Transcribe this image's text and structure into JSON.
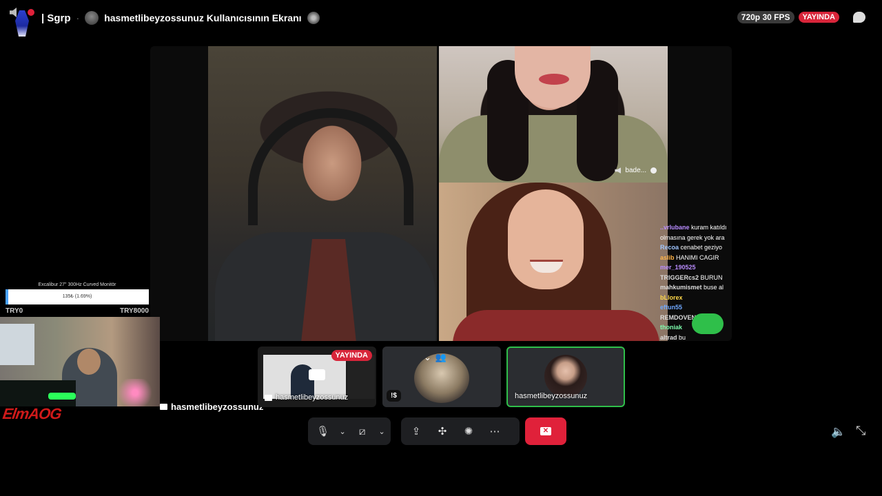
{
  "header": {
    "server_name": "| Sgrp",
    "separator": "·",
    "stream_title": "hasmetlibeyzossunuz Kullanıcısının Ekranı",
    "quality": "720p 30 FPS",
    "live_badge": "YAYINDA"
  },
  "stage": {
    "main_tile_name": "hasmetlibeyzossunuz",
    "top_right_name": "bade...",
    "chat_lines": [
      {
        "user": "..vrlubane",
        "text": "kuram katıldı",
        "color": "#b98cff"
      },
      {
        "user": "",
        "text": "olmasına gerek yok ara",
        "color": "#ddd"
      },
      {
        "user": "Recoa",
        "text": "cenabet geziyo",
        "color": "#9fc5ff"
      },
      {
        "user": "aslib",
        "text": "HANIMI CAGIR",
        "color": "#ffb347"
      },
      {
        "user": "mer_190525",
        "text": "",
        "color": "#b98cff"
      },
      {
        "user": "TRIGGERcs2",
        "text": "BURUN",
        "color": "#ddd"
      },
      {
        "user": "mahkumismet",
        "text": "buse al",
        "color": "#ddd"
      },
      {
        "user": "bLlorex",
        "text": "",
        "color": "#ffd84a"
      },
      {
        "user": "eftun55",
        "text": "",
        "color": "#6fa8ff"
      },
      {
        "user": "REMDOVEN",
        "text": "neden",
        "color": "#ddd"
      },
      {
        "user": "thoniak",
        "text": "",
        "color": "#7fffaf"
      },
      {
        "user": "altrad",
        "text": "bu",
        "color": "#ddd"
      }
    ]
  },
  "goal": {
    "title": "Excalibur 27\" 300Hz Curved Monitör",
    "progress_text": "135₺ (1.69%)",
    "progress": 0.0169,
    "min": "TRY0",
    "max": "TRY8000"
  },
  "logo_text": "ElmAOG",
  "thumbnails": {
    "screen_name": "hasmetlibeyzossunuz",
    "screen_live": "YAYINDA",
    "user_tag": "!$",
    "third_name": "hasmetlibeyzossunuz"
  },
  "colors": {
    "accent_red": "#e0213a",
    "speaking_green": "#2fbf4a",
    "panel": "#2b2d31"
  },
  "icons": {
    "mic": "microphone-icon",
    "camera": "camera-off-icon",
    "share": "screen-share-icon",
    "activities": "activities-icon",
    "soundboard": "soundboard-icon",
    "more": "more-icon",
    "leave": "leave-call-icon",
    "volume": "volume-icon",
    "fullscreen": "exit-fullscreen-icon"
  }
}
